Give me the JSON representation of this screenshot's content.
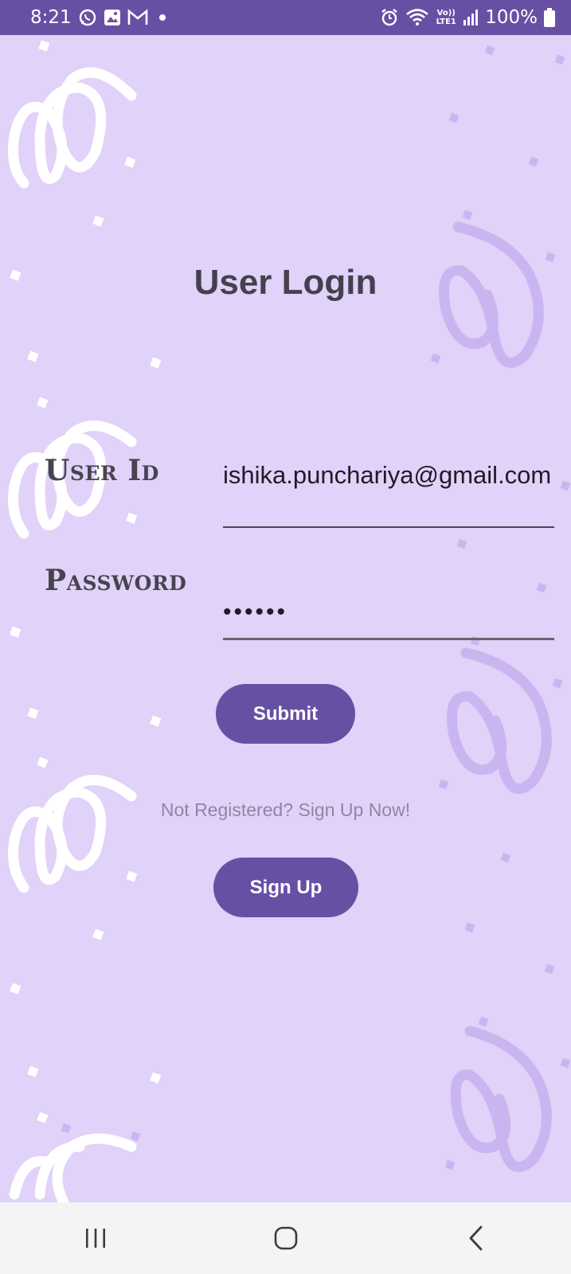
{
  "status_bar": {
    "time": "8:21",
    "left_icons": [
      "whatsapp-icon",
      "gallery-icon",
      "gmail-icon",
      "notification-dot"
    ],
    "right_icons": [
      "alarm-icon",
      "wifi-icon",
      "volte-icon",
      "signal-icon",
      "battery-icon"
    ],
    "volte_label": "Vo)) LTE1",
    "battery_percent": "100%"
  },
  "login": {
    "title": "User Login",
    "user_label": "User Id",
    "user_value": "ishika.punchariya@gmail.com",
    "password_label": "Password",
    "password_masked": "••••••",
    "submit_label": "Submit",
    "hint": "Not Registered? Sign Up Now!",
    "signup_label": "Sign Up"
  },
  "nav_bar": {
    "icons": [
      "recents-icon",
      "home-icon",
      "back-icon"
    ]
  },
  "colors": {
    "background": "#e0d2f8",
    "primary": "#6750a4",
    "title_text": "#45404e",
    "hint_text": "#8e87a3",
    "decor_white": "#ffffff",
    "decor_purple": "#cbb5f1"
  }
}
